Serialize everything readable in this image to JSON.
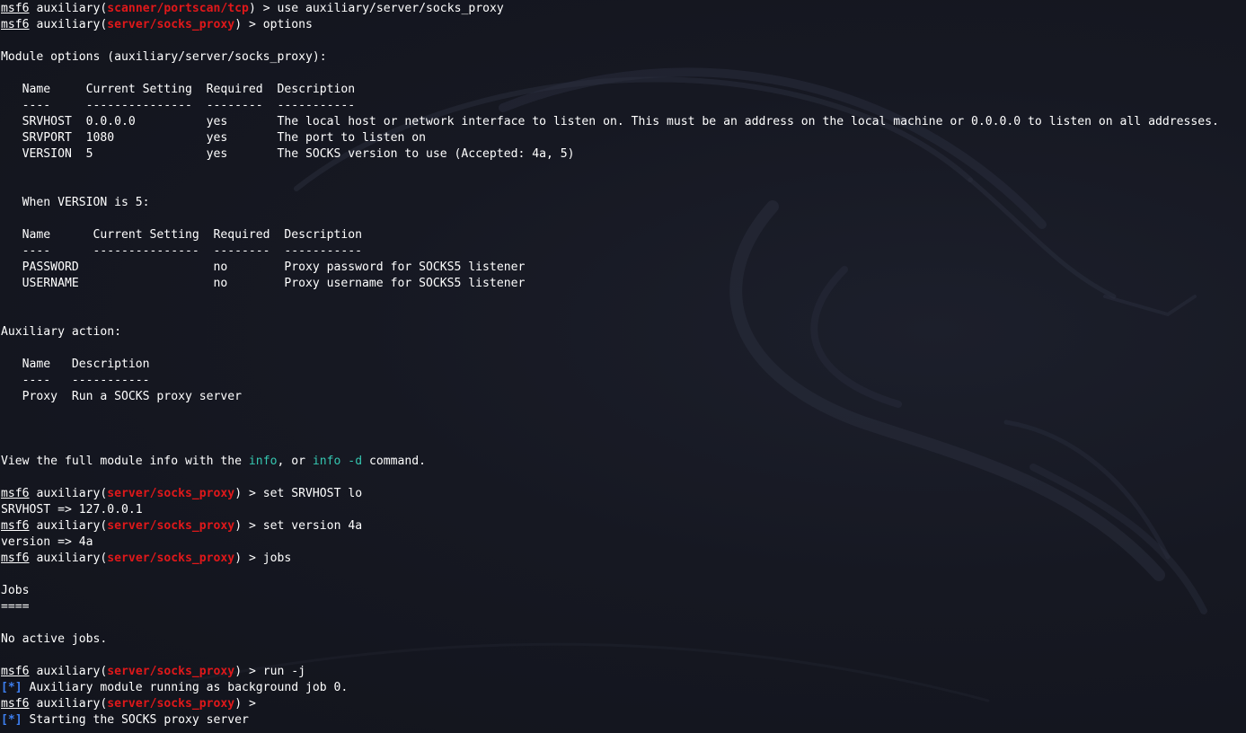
{
  "colors": {
    "background": "#14161f",
    "text": "#ffffff",
    "module_path": "#e0181a",
    "keyword": "#35c6b0",
    "status_marker": "#3d7ff0"
  },
  "background_image": "kali-dragon-watermark",
  "prompt": {
    "name": "msf6",
    "type": "auxiliary",
    "open": "(",
    "close": ")",
    "arrow": " > "
  },
  "commands": {
    "c1": {
      "module": "scanner/portscan/tcp",
      "text": "use auxiliary/server/socks_proxy"
    },
    "c2": {
      "module": "server/socks_proxy",
      "text": "options"
    },
    "c3": {
      "module": "server/socks_proxy",
      "text": "set SRVHOST lo"
    },
    "c4": {
      "module": "server/socks_proxy",
      "text": "set version 4a"
    },
    "c5": {
      "module": "server/socks_proxy",
      "text": "jobs"
    },
    "c6": {
      "module": "server/socks_proxy",
      "text": "run -j"
    },
    "c7": {
      "module": "server/socks_proxy",
      "text": ""
    }
  },
  "module_options": {
    "title": "Module options (auxiliary/server/socks_proxy):",
    "header": "   Name     Current Setting  Required  Description",
    "underline": "   ----     ---------------  --------  -----------",
    "rows": [
      "   SRVHOST  0.0.0.0          yes       The local host or network interface to listen on. This must be an address on the local machine or 0.0.0.0 to listen on all addresses.",
      "   SRVPORT  1080             yes       The port to listen on",
      "   VERSION  5                yes       The SOCKS version to use (Accepted: 4a, 5)"
    ]
  },
  "version5_options": {
    "title": "   When VERSION is 5:",
    "header": "   Name      Current Setting  Required  Description",
    "underline": "   ----      ---------------  --------  -----------",
    "rows": [
      "   PASSWORD                   no        Proxy password for SOCKS5 listener",
      "   USERNAME                   no        Proxy username for SOCKS5 listener"
    ]
  },
  "aux_action": {
    "title": "Auxiliary action:",
    "header": "   Name   Description",
    "underline": "   ----   -----------",
    "rows": [
      "   Proxy  Run a SOCKS proxy server"
    ]
  },
  "info_line": {
    "before": "View the full module info with the ",
    "kw1": "info",
    "middle": ", or ",
    "kw2": "info -d",
    "after": " command."
  },
  "outputs": {
    "srvhost": "SRVHOST => 127.0.0.1",
    "version": "version => 4a",
    "jobs_title": "Jobs",
    "jobs_underline": "====",
    "no_jobs": "No active jobs.",
    "star": "[*]",
    "running": " Auxiliary module running as background job 0.",
    "starting": " Starting the SOCKS proxy server"
  }
}
